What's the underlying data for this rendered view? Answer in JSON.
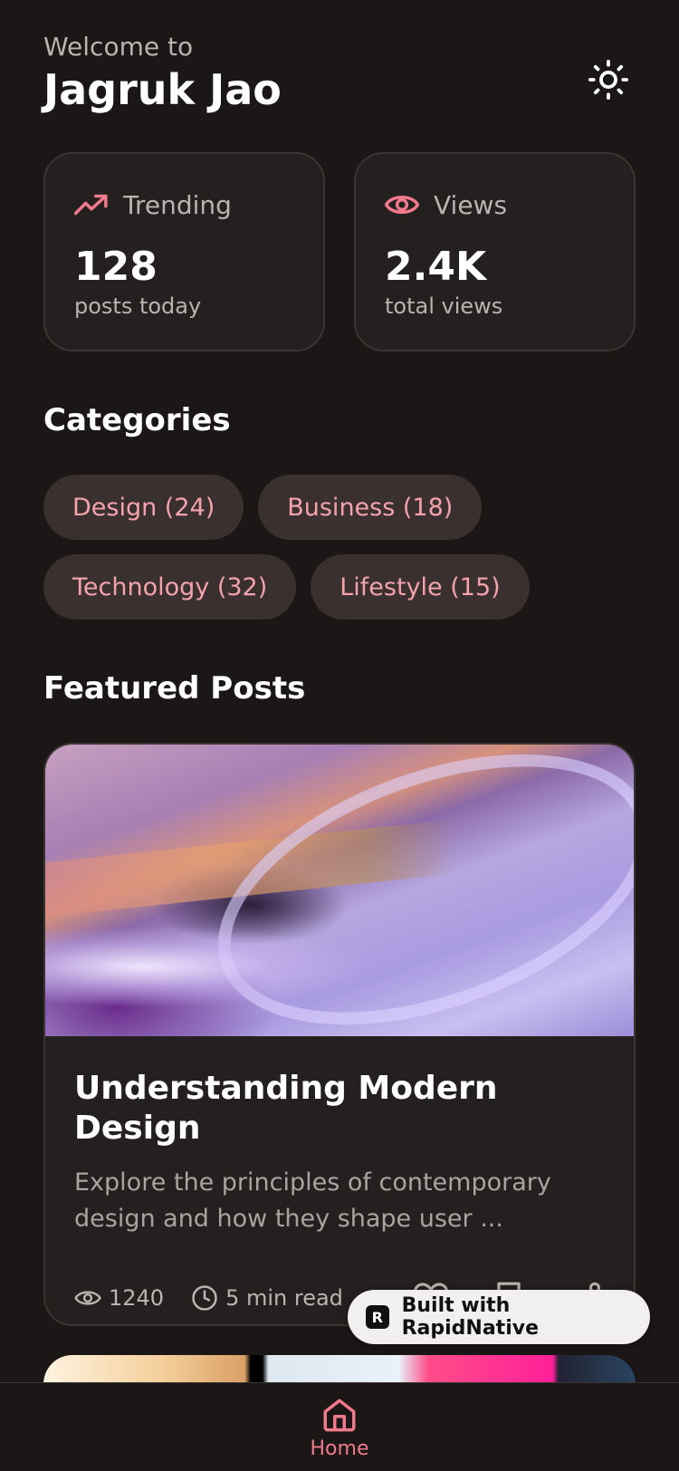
{
  "header": {
    "welcome": "Welcome to",
    "title": "Jagruk Jao"
  },
  "stats": [
    {
      "label": "Trending",
      "value": "128",
      "sub": "posts today",
      "icon": "trending-up-icon"
    },
    {
      "label": "Views",
      "value": "2.4K",
      "sub": "total views",
      "icon": "eye-icon"
    }
  ],
  "categories": {
    "title": "Categories",
    "items": [
      "Design (24)",
      "Business (18)",
      "Technology (32)",
      "Lifestyle (15)"
    ]
  },
  "featured": {
    "title": "Featured Posts",
    "post": {
      "title": "Understanding Modern Design",
      "excerpt": "Explore the principles of contemporary design and how they shape user ...",
      "views": "1240",
      "read_time": "5 min read"
    }
  },
  "badge": {
    "label": "Built with RapidNative"
  },
  "tabbar": {
    "home_label": "Home"
  },
  "colors": {
    "background": "#1b1716",
    "card": "#24201f",
    "accent": "#f07a8c",
    "chip_bg": "#3a302f",
    "chip_text": "#f4a3ad"
  }
}
